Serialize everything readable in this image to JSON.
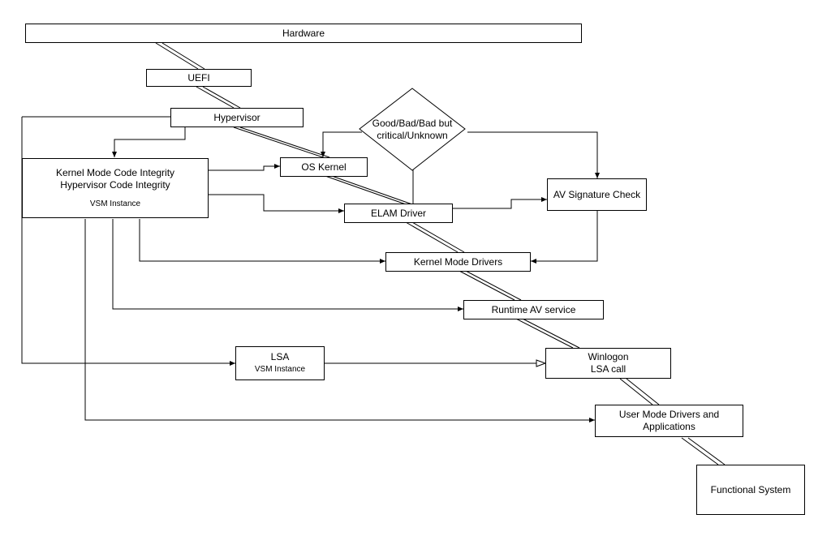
{
  "nodes": {
    "hardware": "Hardware",
    "uefi": "UEFI",
    "hypervisor": "Hypervisor",
    "kmci": {
      "line1": "Kernel Mode Code Integrity",
      "line2": "Hypervisor Code Integrity",
      "sub": "VSM Instance"
    },
    "os_kernel": "OS Kernel",
    "decision": "Good/Bad/Bad but critical/Unknown",
    "elam": "ELAM Driver",
    "av_sig": "AV Signature Check",
    "km_drivers": "Kernel Mode Drivers",
    "runtime_av": "Runtime AV service",
    "lsa": {
      "title": "LSA",
      "sub": "VSM Instance"
    },
    "winlogon": {
      "line1": "Winlogon",
      "line2": "LSA call"
    },
    "user_mode": "User Mode Drivers and Applications",
    "functional": "Functional System"
  }
}
